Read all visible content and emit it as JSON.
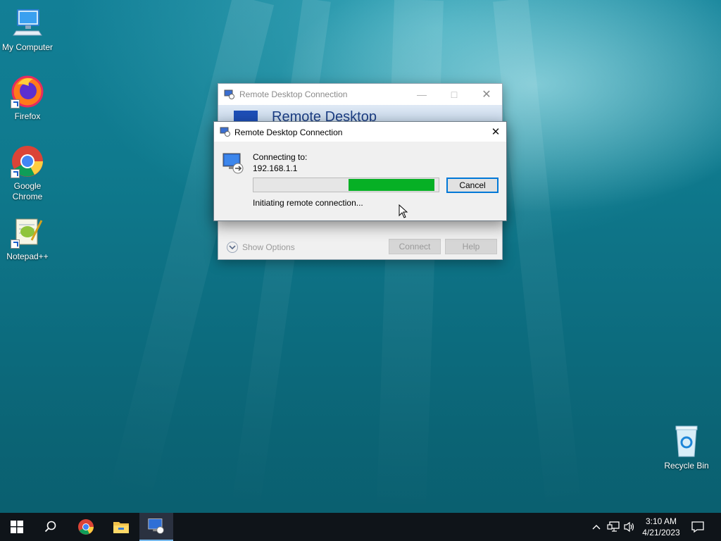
{
  "desktop": {
    "icons": [
      {
        "label": "My Computer"
      },
      {
        "label": "Firefox"
      },
      {
        "label": "Google Chrome"
      },
      {
        "label": "Notepad++"
      },
      {
        "label": "Recycle Bin"
      }
    ]
  },
  "background_window": {
    "title": "Remote Desktop Connection",
    "banner_text": "Remote Desktop",
    "show_options": "Show Options",
    "connect_label": "Connect",
    "help_label": "Help"
  },
  "dialog": {
    "title": "Remote Desktop Connection",
    "connecting_to_label": "Connecting to:",
    "address": "192.168.1.1",
    "status": "Initiating remote connection...",
    "cancel_label": "Cancel",
    "progress_fraction": 0.48
  },
  "taskbar": {
    "time": "3:10 AM",
    "date": "4/21/2023",
    "items": [
      "start-icon",
      "search-icon",
      "chrome-icon",
      "file-explorer-icon",
      "remote-desktop-icon"
    ]
  },
  "colors": {
    "accent": "#0078d7",
    "progress": "#06b025",
    "taskbar": "#0f1419"
  }
}
